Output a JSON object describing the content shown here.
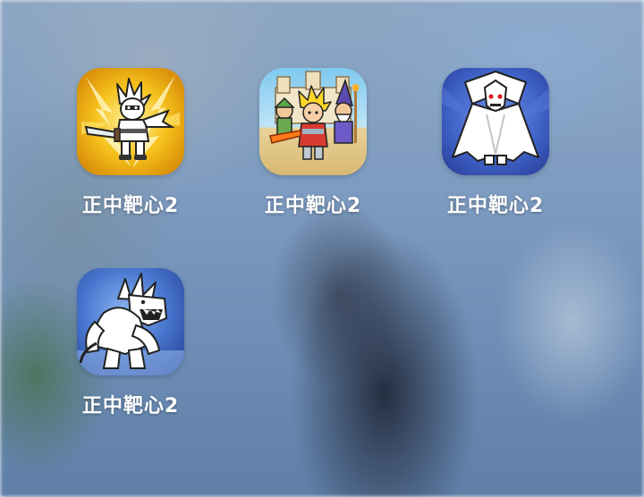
{
  "home_screen": {
    "apps": [
      {
        "label": "正中靶心2",
        "icon": "hero-sword-lightning-icon"
      },
      {
        "label": "正中靶心2",
        "icon": "hero-party-castle-icon"
      },
      {
        "label": "正中靶心2",
        "icon": "vampire-caped-icon"
      },
      {
        "label": "正中靶心2",
        "icon": "spiked-beast-icon"
      }
    ]
  },
  "colors": {
    "label": "#ffffff",
    "icon1_bg": "#f2b417",
    "icon2_bg": "#f0d9a0",
    "icon3_bg": "#3f63c8",
    "icon4_bg": "#3e68c2"
  }
}
